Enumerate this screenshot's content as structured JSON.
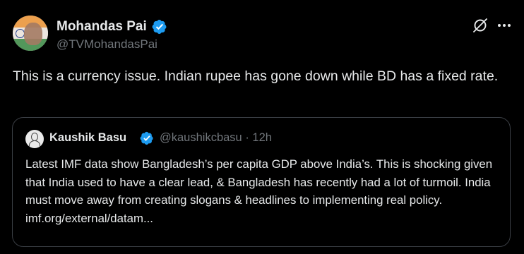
{
  "tweet": {
    "author_name": "Mohandas Pai",
    "author_handle": "@TVMohandasPai",
    "text": "This is a currency issue. Indian rupee has gone down while BD has a fixed rate."
  },
  "quoted_tweet": {
    "author_name": "Kaushik Basu",
    "author_handle": "@kaushikcbasu",
    "separator": "·",
    "time": "12h",
    "text": "Latest IMF data show Bangladesh’s per capita GDP above India’s. This is shocking given that India used to have a clear lead, & Bangladesh has recently had a lot of turmoil. India must move away from creating slogans & headlines to implementing real policy.",
    "link": "imf.org/external/datam..."
  },
  "icons": {
    "verified": "verified-badge-icon",
    "grok": "grok-icon",
    "more": "more-options-icon"
  },
  "colors": {
    "background": "#000000",
    "text_primary": "#e7e9ea",
    "text_secondary": "#71767b",
    "verified_blue": "#1d9bf0",
    "border": "#3a3e44"
  }
}
